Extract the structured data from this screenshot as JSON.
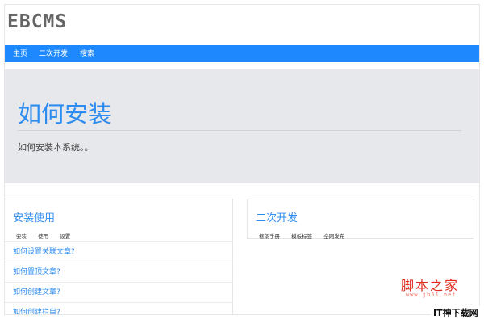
{
  "site": {
    "brand": "EBCMS"
  },
  "nav": {
    "items": [
      "主页",
      "二次开发",
      "搜索"
    ]
  },
  "jumbotron": {
    "title": "如何安装",
    "lead": "如何安装本系统。。"
  },
  "panel_install": {
    "title": "安装使用",
    "tags": [
      "安装",
      "使用",
      "设置"
    ],
    "links": [
      "如何设置关联文章?",
      "如何置顶文章?",
      "如何创建文章?",
      "如何创建栏目?"
    ]
  },
  "panel_dev": {
    "title": "二次开发",
    "tags": [
      "框架手册",
      "模板标签",
      "全网发布"
    ]
  },
  "watermark": {
    "text": "脚本之家",
    "url": "www.jb51.net",
    "corner": "IT神下载网"
  }
}
